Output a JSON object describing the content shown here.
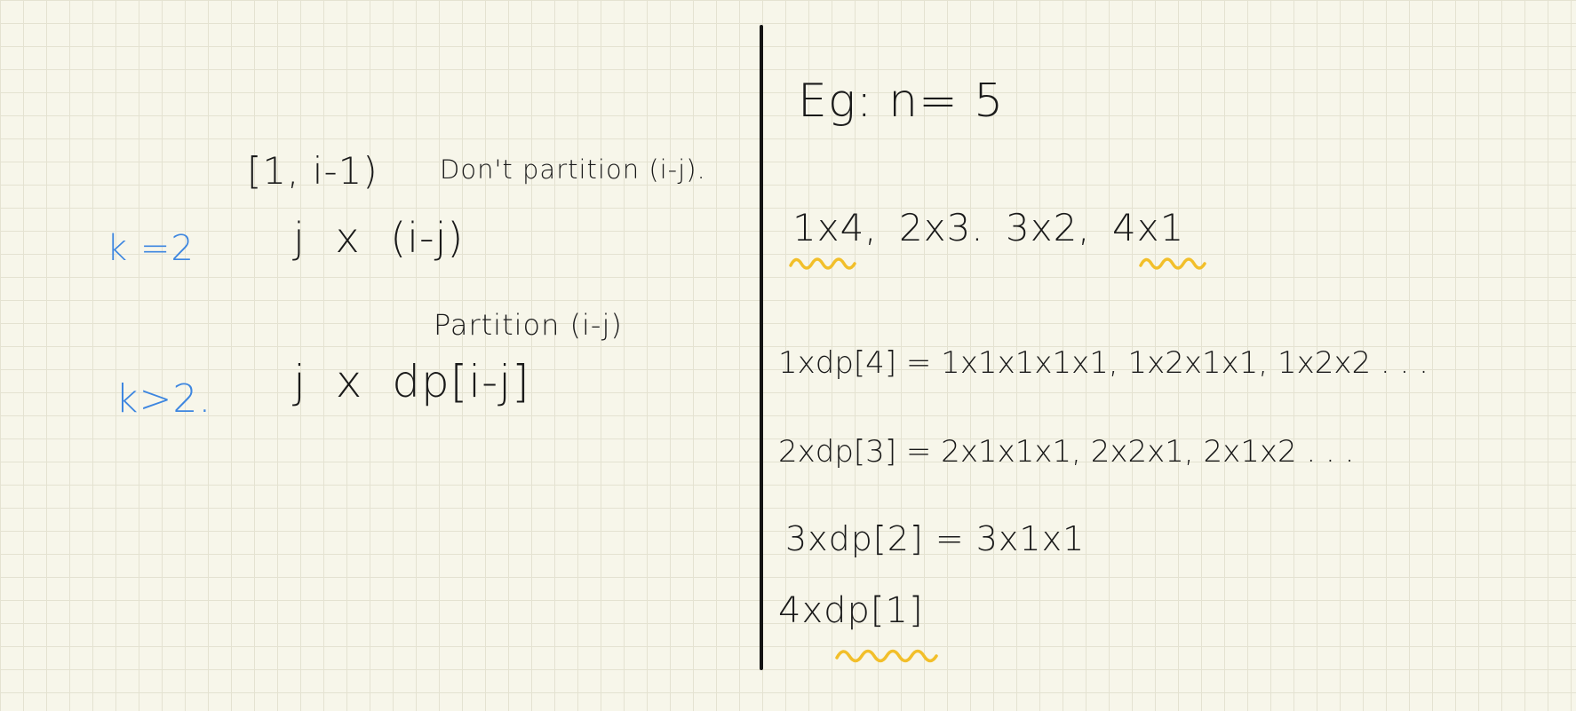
{
  "left": {
    "range_note": "[1, i-1)",
    "dont_partition_note": "Don't partition (i-j).",
    "case_k2": {
      "label": "k =2",
      "expr": "j x (i-j)"
    },
    "partition_note": "Partition (i-j)",
    "case_kgt2": {
      "label": "k>2.",
      "expr": "j x dp[i-j]"
    }
  },
  "right": {
    "example": "Eg: n= 5",
    "pairs": "1x4, 2x3. 3x2, 4x1",
    "lines": [
      "1xdp[4] = 1x1x1x1x1, 1x2x1x1, 1x2x2 . . .",
      "2xdp[3] = 2x1x1x1, 2x2x1, 2x1x2 . . .",
      "3xdp[2] = 3x1x1",
      "4xdp[1]"
    ]
  },
  "colors": {
    "ink": "#1a1a1a",
    "case_label": "#3d86e0",
    "highlight": "#f2bf2a",
    "paper": "#f7f6ea",
    "grid": "#e4e2d1"
  }
}
